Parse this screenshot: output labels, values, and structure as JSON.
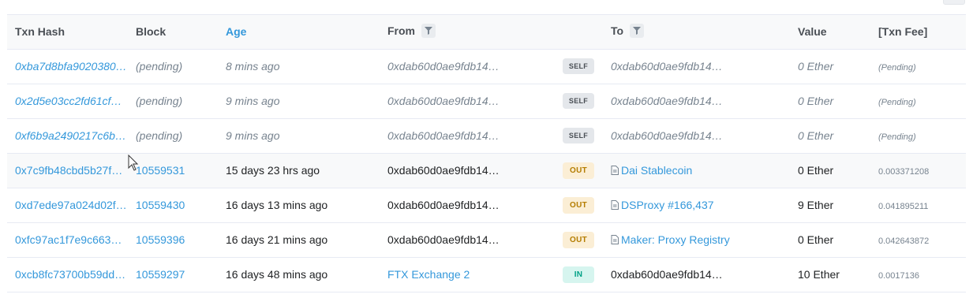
{
  "columns": {
    "hash": "Txn Hash",
    "block": "Block",
    "age": "Age",
    "from": "From",
    "to": "To",
    "value": "Value",
    "fee": "[Txn Fee]"
  },
  "rows": [
    {
      "hash": "0xba7d8bfa9020380…",
      "block": "(pending)",
      "age": "8 mins ago",
      "from": "0xdab60d0ae9fdb14…",
      "dir": "SELF",
      "to": "0xdab60d0ae9fdb14…",
      "value": "0 Ether",
      "fee": "(Pending)"
    },
    {
      "hash": "0x2d5e03cc2fd61cf…",
      "block": "(pending)",
      "age": "9 mins ago",
      "from": "0xdab60d0ae9fdb14…",
      "dir": "SELF",
      "to": "0xdab60d0ae9fdb14…",
      "value": "0 Ether",
      "fee": "(Pending)"
    },
    {
      "hash": "0xf6b9a2490217c6b…",
      "block": "(pending)",
      "age": "9 mins ago",
      "from": "0xdab60d0ae9fdb14…",
      "dir": "SELF",
      "to": "0xdab60d0ae9fdb14…",
      "value": "0 Ether",
      "fee": "(Pending)"
    },
    {
      "hash": "0x7c9fb48cbd5b27f…",
      "block": "10559531",
      "age": "15 days 23 hrs ago",
      "from": "0xdab60d0ae9fdb14…",
      "dir": "OUT",
      "to": "Dai Stablecoin",
      "value": "0 Ether",
      "fee": "0.003371208"
    },
    {
      "hash": "0xd7ede97a024d02f…",
      "block": "10559430",
      "age": "16 days 13 mins ago",
      "from": "0xdab60d0ae9fdb14…",
      "dir": "OUT",
      "to": "DSProxy #166,437",
      "value": "9 Ether",
      "fee": "0.041895211"
    },
    {
      "hash": "0xfc97ac1f7e9c663…",
      "block": "10559396",
      "age": "16 days 21 mins ago",
      "from": "0xdab60d0ae9fdb14…",
      "dir": "OUT",
      "to": "Maker: Proxy Registry",
      "value": "0 Ether",
      "fee": "0.042643872"
    },
    {
      "hash": "0xcb8fc73700b59dd…",
      "block": "10559297",
      "age": "16 days 48 mins ago",
      "from": "FTX Exchange 2",
      "dir": "IN",
      "to": "0xdab60d0ae9fdb14…",
      "value": "10 Ether",
      "fee": "0.0017136"
    }
  ],
  "icons": {
    "filter": "filter-icon",
    "contract": "contract-doc-icon",
    "cursor": "mouse-pointer-icon"
  },
  "colors": {
    "link": "#3498db",
    "self_badge": "#e4e7eb",
    "out_badge": "#fbeed5",
    "in_badge": "#d6f5ef"
  }
}
